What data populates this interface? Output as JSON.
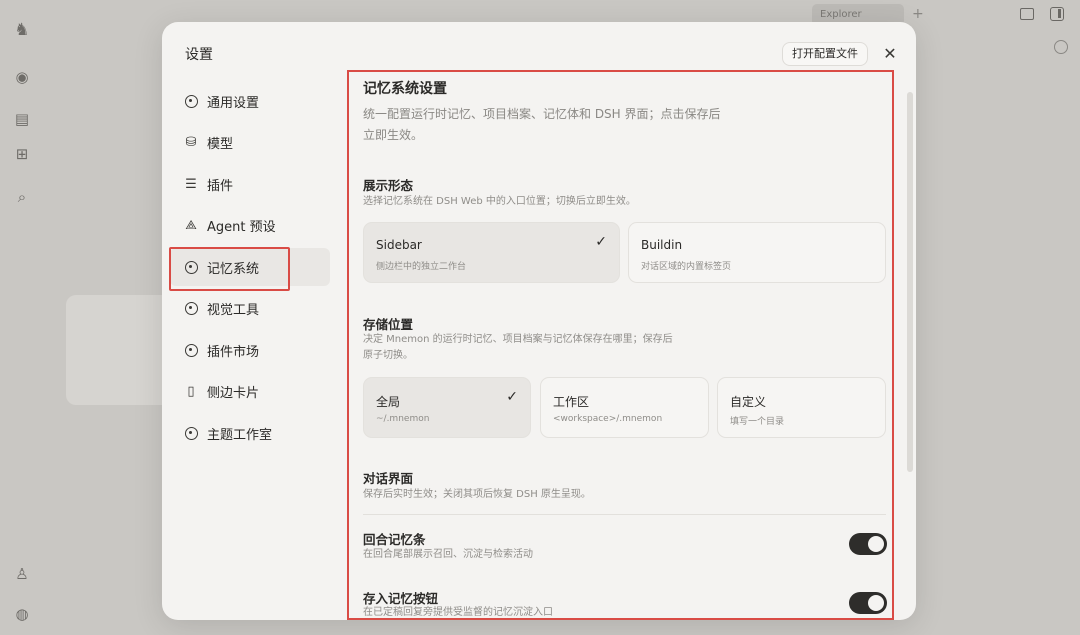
{
  "background": {
    "tab_label": "Explorer",
    "rail_icons": [
      "app-logo-icon",
      "home-icon",
      "doc-icon",
      "folder-plus-icon",
      "search-icon",
      "user-icon",
      "settings-icon"
    ]
  },
  "modal": {
    "title": "设置",
    "open_config_label": "打开配置文件",
    "close_label": "✕"
  },
  "sidebar": {
    "items": [
      {
        "label": "通用设置",
        "icon": "gear-icon"
      },
      {
        "label": "模型",
        "icon": "database-icon"
      },
      {
        "label": "插件",
        "icon": "sliders-icon"
      },
      {
        "label": "Agent 预设",
        "icon": "shapes-icon"
      },
      {
        "label": "记忆系统",
        "icon": "gear-icon",
        "active": true
      },
      {
        "label": "视觉工具",
        "icon": "gear-icon"
      },
      {
        "label": "插件市场",
        "icon": "gear-icon"
      },
      {
        "label": "侧边卡片",
        "icon": "panel-icon"
      },
      {
        "label": "主题工作室",
        "icon": "gear-icon"
      }
    ]
  },
  "content": {
    "title": "记忆系统设置",
    "desc_line1": "统一配置运行时记忆、项目档案、记忆体和 DSH 界面；点击保存后",
    "desc_line2": "立即生效。",
    "display": {
      "heading": "展示形态",
      "desc": "选择记忆系统在 DSH Web 中的入口位置；切换后立即生效。",
      "options": [
        {
          "title": "Sidebar",
          "subtitle": "侧边栏中的独立二作台",
          "selected": true
        },
        {
          "title": "Buildin",
          "subtitle": "对话区域的内置标签页",
          "selected": false
        }
      ]
    },
    "storage": {
      "heading": "存储位置",
      "desc_line1": "决定 Mnemon 的运行时记忆、项目档案与记忆体保存在哪里；保存后",
      "desc_line2": "原子切换。",
      "options": [
        {
          "title": "全局",
          "subtitle": "~/.mnemon",
          "selected": true
        },
        {
          "title": "工作区",
          "subtitle": "<workspace>/.mnemon",
          "selected": false
        },
        {
          "title": "自定义",
          "subtitle": "填写一个目录",
          "selected": false
        }
      ]
    },
    "chat": {
      "heading": "对话界面",
      "desc": "保存后实时生效；关闭其项后恢复 DSH 原生呈现。",
      "toggles": [
        {
          "label": "回合记忆条",
          "desc": "在回合尾部展示召回、沉淀与检索活动",
          "on": true
        },
        {
          "label": "存入记忆按钮",
          "desc": "在已定稿回复旁提供受监督的记忆沉淀入口",
          "on": true
        }
      ]
    }
  },
  "colors": {
    "accent_red": "#d94b45",
    "toggle_on": "#2e2d2b",
    "selected_card": "#e8e6e3"
  }
}
